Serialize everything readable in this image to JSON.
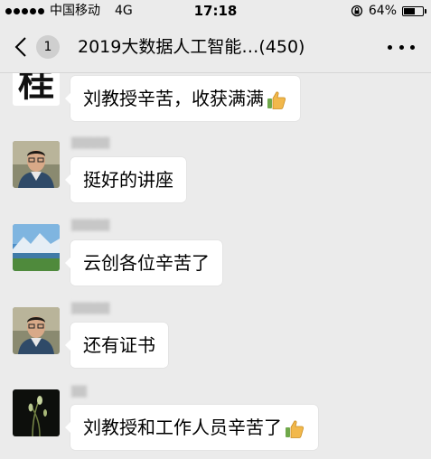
{
  "status": {
    "carrier": "中国移动",
    "network": "4G",
    "time": "17:18",
    "battery": "64%",
    "battery_level": 0.64
  },
  "nav": {
    "unread_count": "1",
    "title": "2019大数据人工智能…(450)"
  },
  "messages": [
    {
      "text": "刘教授辛苦，收获满满",
      "has_thumb": true,
      "avatar_text": "桂"
    },
    {
      "text": "挺好的讲座",
      "has_thumb": false
    },
    {
      "text": "云创各位辛苦了",
      "has_thumb": false
    },
    {
      "text": "还有证书",
      "has_thumb": false
    },
    {
      "text": "刘教授和工作人员辛苦了",
      "has_thumb": true
    }
  ],
  "colors": {
    "background": "#ebebeb",
    "bubble": "#ffffff",
    "badge": "#cfcfcf",
    "thumb": "#f2b84b"
  }
}
